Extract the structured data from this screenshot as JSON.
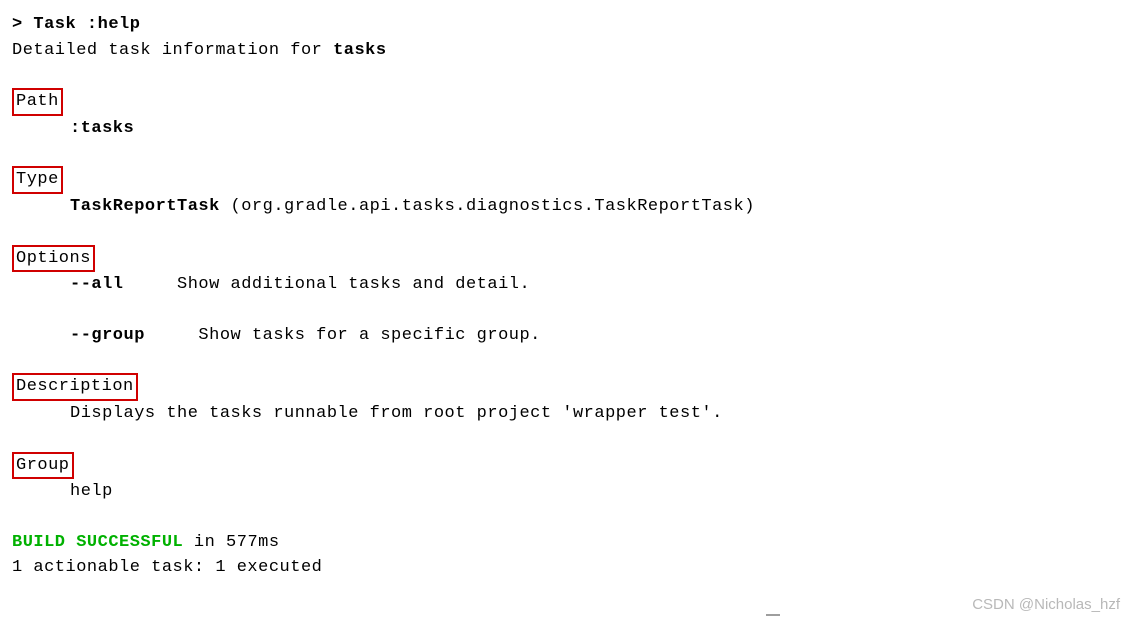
{
  "header": {
    "prompt": "> ",
    "task_label": "Task :help",
    "detail_prefix": "Detailed task information for ",
    "detail_subject": "tasks"
  },
  "sections": {
    "path": {
      "label": "Path",
      "value": ":tasks"
    },
    "type": {
      "label": "Type",
      "value_bold": "TaskReportTask",
      "value_rest": " (org.gradle.api.tasks.diagnostics.TaskReportTask)"
    },
    "options": {
      "label": "Options",
      "items": [
        {
          "flag": "--all",
          "desc": "     Show additional tasks and detail."
        },
        {
          "flag": "--group",
          "desc": "     Show tasks for a specific group."
        }
      ]
    },
    "description": {
      "label": "Description",
      "value": "Displays the tasks runnable from root project 'wrapper test'."
    },
    "group": {
      "label": "Group",
      "value": "help"
    }
  },
  "footer": {
    "build_status": "BUILD SUCCESSFUL",
    "build_time": " in 577ms",
    "summary": "1 actionable task: 1 executed"
  },
  "watermark": "CSDN @Nicholas_hzf"
}
